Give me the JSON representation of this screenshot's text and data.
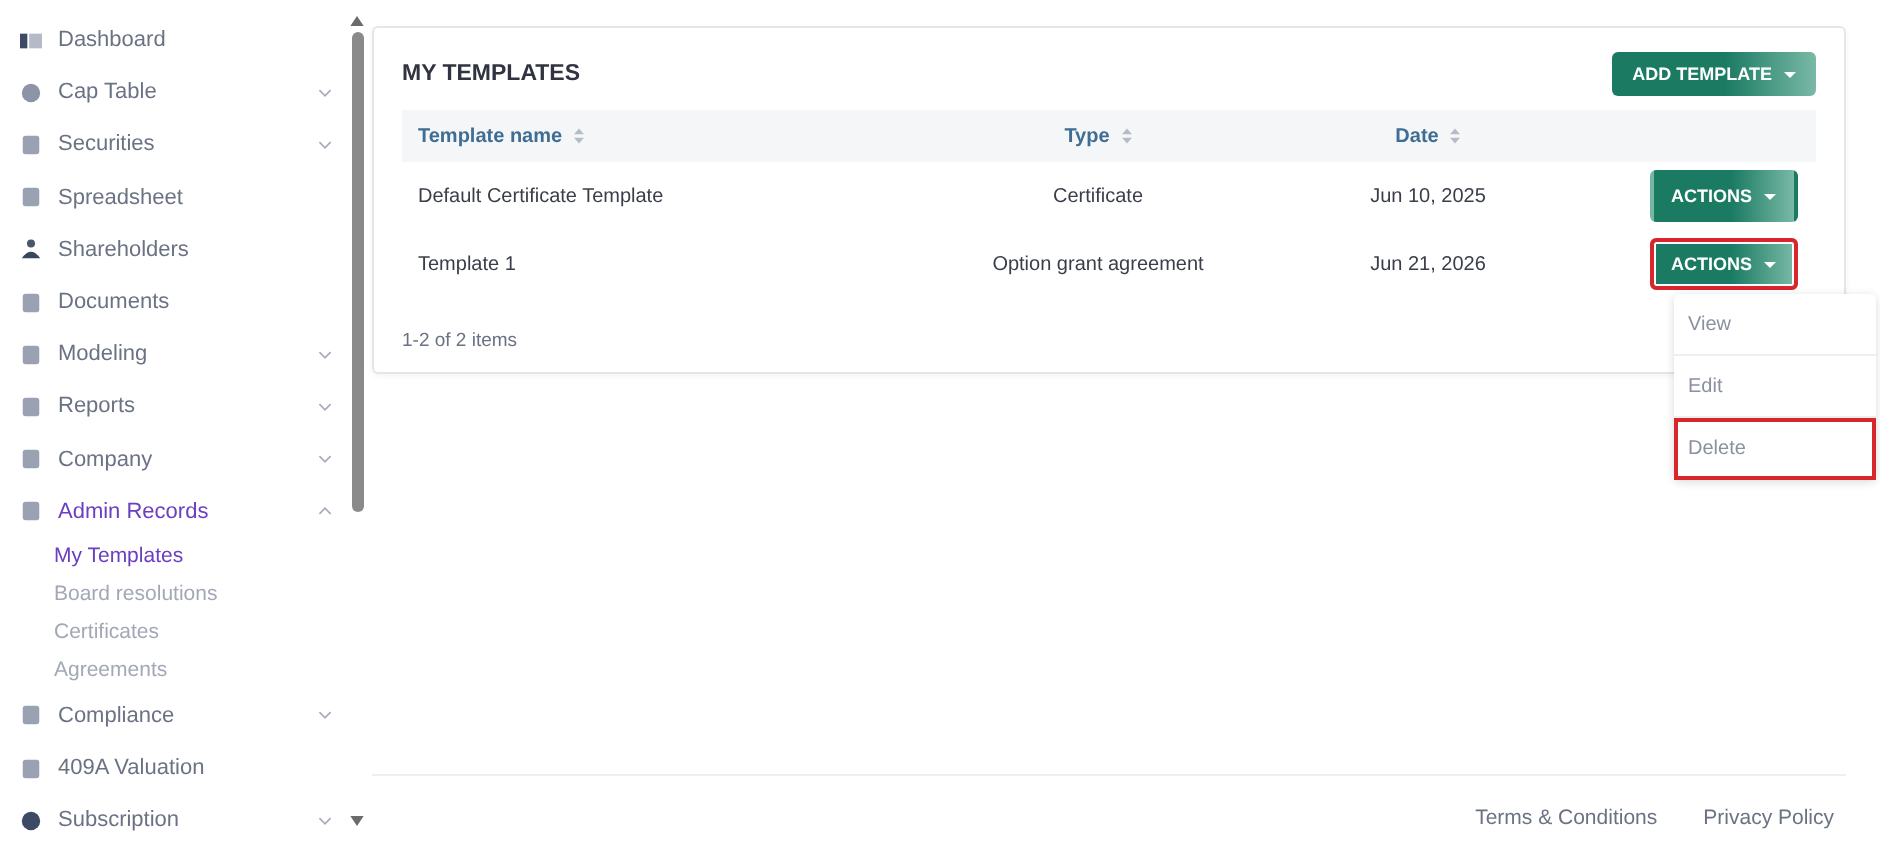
{
  "sidebar": {
    "items": [
      {
        "label": "Dashboard",
        "expandable": false,
        "selected": false
      },
      {
        "label": "Cap Table",
        "expandable": true,
        "expanded": false,
        "selected": false
      },
      {
        "label": "Securities",
        "expandable": true,
        "expanded": false,
        "selected": false
      },
      {
        "label": "Spreadsheet",
        "expandable": false,
        "selected": false
      },
      {
        "label": "Shareholders",
        "expandable": false,
        "selected": false
      },
      {
        "label": "Documents",
        "expandable": false,
        "selected": false
      },
      {
        "label": "Modeling",
        "expandable": true,
        "expanded": false,
        "selected": false
      },
      {
        "label": "Reports",
        "expandable": true,
        "expanded": false,
        "selected": false
      },
      {
        "label": "Company",
        "expandable": true,
        "expanded": false,
        "selected": false
      },
      {
        "label": "Admin Records",
        "expandable": true,
        "expanded": true,
        "selected": true,
        "children": [
          {
            "label": "My Templates",
            "selected": true
          },
          {
            "label": "Board resolutions",
            "selected": false
          },
          {
            "label": "Certificates",
            "selected": false
          },
          {
            "label": "Agreements",
            "selected": false
          }
        ]
      },
      {
        "label": "Compliance",
        "expandable": true,
        "expanded": false,
        "selected": false
      },
      {
        "label": "409A Valuation",
        "expandable": false,
        "selected": false
      },
      {
        "label": "Subscription",
        "expandable": true,
        "expanded": false,
        "selected": false
      }
    ]
  },
  "card": {
    "title": "MY TEMPLATES",
    "add_button": "ADD TEMPLATE",
    "table": {
      "columns": [
        "Template name",
        "Type",
        "Date"
      ],
      "rows": [
        {
          "cells": [
            "Default Certificate Template",
            "Certificate",
            "Jun 10, 2025"
          ],
          "action": "ACTIONS",
          "highlighted": false,
          "menu_open": false
        },
        {
          "cells": [
            "Template 1",
            "Option grant agreement",
            "Jun 21, 2026"
          ],
          "action": "ACTIONS",
          "highlighted": true,
          "menu_open": true
        }
      ]
    },
    "pagination": "1-2 of 2 items"
  },
  "menu": {
    "items": [
      {
        "label": "View",
        "highlighted": false
      },
      {
        "label": "Edit",
        "highlighted": false
      },
      {
        "label": "Delete",
        "highlighted": true
      }
    ]
  },
  "footer": {
    "links": [
      "Terms & Conditions",
      "Privacy Policy"
    ]
  }
}
